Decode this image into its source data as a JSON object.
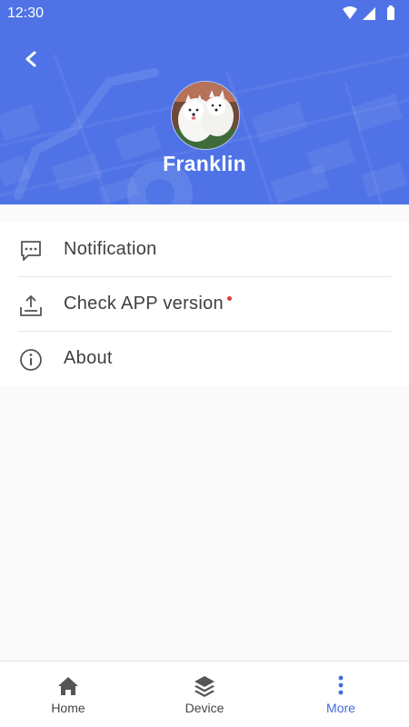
{
  "status_bar": {
    "time": "12:30",
    "icons": [
      "wifi-icon",
      "signal-icon",
      "battery-icon"
    ]
  },
  "header": {
    "back_icon": "chevron-left-icon",
    "avatar_image": "dog-photo-avatar",
    "name": "Franklin"
  },
  "menu": {
    "items": [
      {
        "label": "Notification",
        "icon": "chat-bubble-icon"
      },
      {
        "label": "Check APP version",
        "icon": "upload-tray-icon",
        "has_update_dot": true
      },
      {
        "label": "About",
        "icon": "info-circle-icon"
      }
    ]
  },
  "bottom_nav": {
    "tabs": [
      {
        "label": "Home",
        "icon": "home-icon"
      },
      {
        "label": "Device",
        "icon": "layers-icon"
      },
      {
        "label": "More",
        "icon": "more-vertical-icon",
        "active": true
      }
    ]
  },
  "colors": {
    "header_blue": "#4f73e6",
    "active_tab": "#3f6ae0",
    "update_dot": "#e53935",
    "page_background": "#fafafa"
  }
}
